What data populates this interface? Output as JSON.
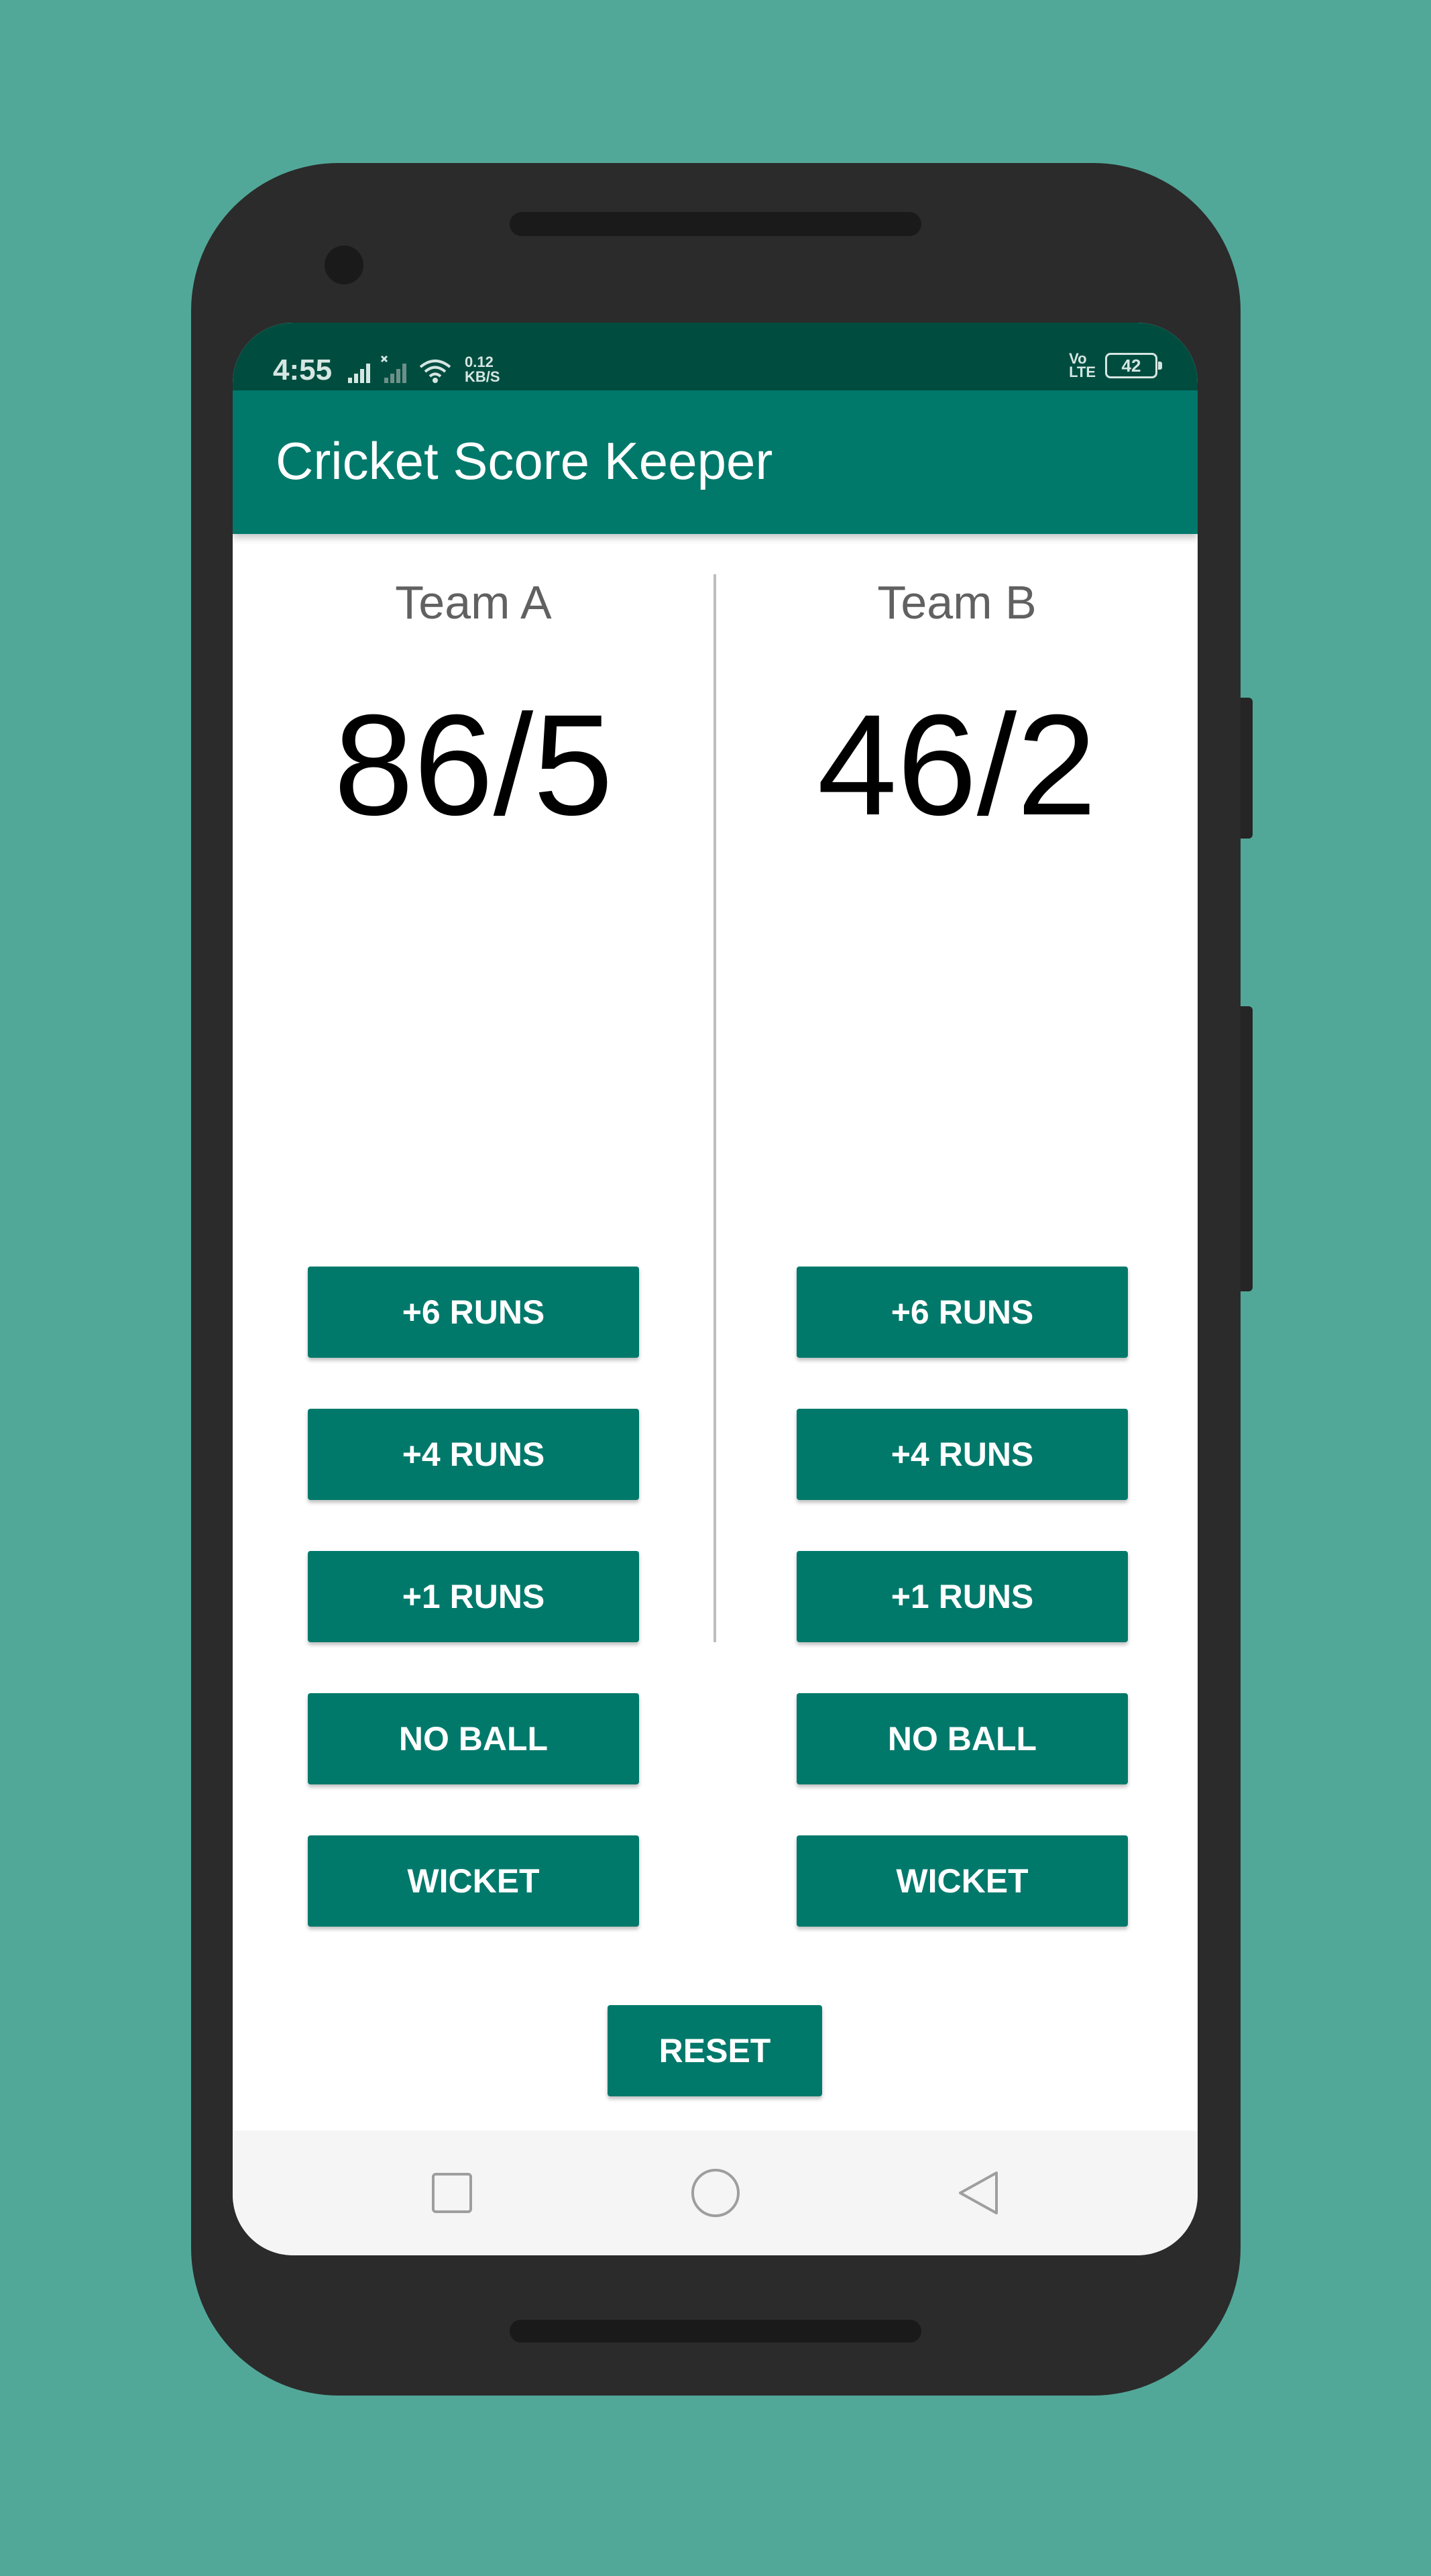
{
  "status_bar": {
    "time": "4:55",
    "network_speed_value": "0.12",
    "network_speed_unit": "KB/S",
    "volte_line1": "Vo",
    "volte_line2": "LTE",
    "battery": "42"
  },
  "app_bar": {
    "title": "Cricket Score Keeper"
  },
  "teams": [
    {
      "name": "Team A",
      "score": "86/5",
      "buttons": [
        "+6 RUNS",
        "+4 RUNS",
        "+1 RUNS",
        "NO BALL",
        "WICKET"
      ]
    },
    {
      "name": "Team B",
      "score": "46/2",
      "buttons": [
        "+6 RUNS",
        "+4 RUNS",
        "+1 RUNS",
        "NO BALL",
        "WICKET"
      ]
    }
  ],
  "reset_label": "RESET",
  "icons": {
    "signal": "signal-icon",
    "signal_no_sim": "signal-no-sim-icon",
    "wifi": "wifi-icon",
    "battery": "battery-icon",
    "nav_recents": "square-icon",
    "nav_home": "circle-icon",
    "nav_back": "triangle-back-icon"
  },
  "colors": {
    "background": "#52A898",
    "primary": "#00796B",
    "primary_dark": "#004D40",
    "divider": "#BDBDBD",
    "team_label": "#616161"
  }
}
